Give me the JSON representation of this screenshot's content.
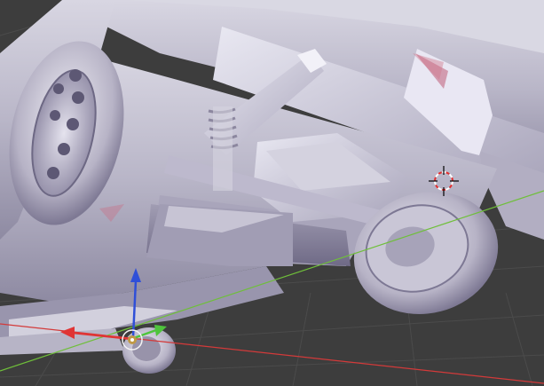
{
  "app": {
    "name": "3D Viewport",
    "shading_mode": "solid"
  },
  "scene": {
    "subject": "car-underside-model",
    "colors": {
      "background": "#3d3d3d",
      "grid_line": "#4a4a4a",
      "axis_x": "#d33a3a",
      "axis_y": "#6fbf3a",
      "axis_z": "#2f4fd8",
      "model_body": "#c9c7d6",
      "model_shadow": "#8f8ba4",
      "model_highlight": "#f1f0f8",
      "cursor_ring_red": "#e03030",
      "cursor_ring_white": "#ffffff"
    }
  },
  "gizmo": {
    "handles": [
      "x-axis-handle",
      "y-axis-handle",
      "z-axis-handle"
    ]
  }
}
